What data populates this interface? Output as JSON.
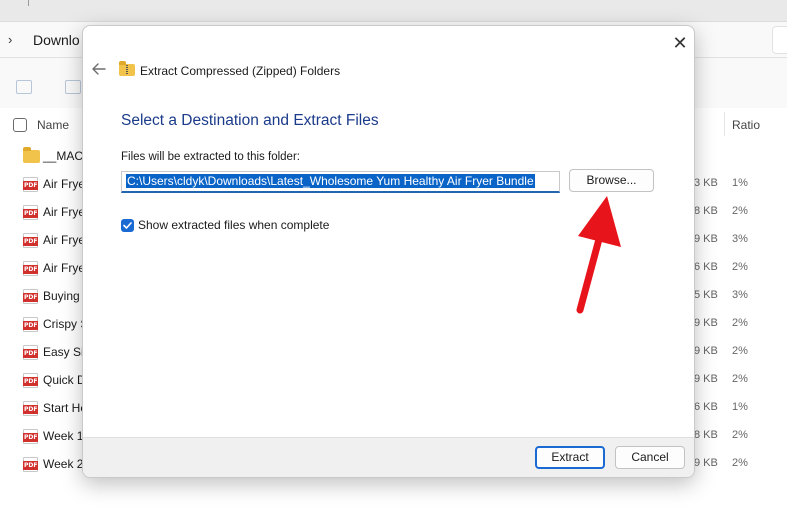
{
  "explorer": {
    "address": "Downlo",
    "columns": {
      "name": "Name",
      "ratio": "Ratio"
    },
    "files": [
      {
        "name": "__MACO",
        "size": "",
        "ratio": "",
        "icon": "folder-icon"
      },
      {
        "name": "Air Frye",
        "size": "3 KB",
        "ratio": "1%",
        "icon": "pdf-icon"
      },
      {
        "name": "Air Frye",
        "size": "8 KB",
        "ratio": "2%",
        "icon": "pdf-icon"
      },
      {
        "name": "Air Frye",
        "size": "9 KB",
        "ratio": "3%",
        "icon": "pdf-icon"
      },
      {
        "name": "Air Frye",
        "size": "6 KB",
        "ratio": "2%",
        "icon": "pdf-icon"
      },
      {
        "name": "Buying",
        "size": "5 KB",
        "ratio": "3%",
        "icon": "pdf-icon"
      },
      {
        "name": "Crispy S",
        "size": "9 KB",
        "ratio": "2%",
        "icon": "pdf-icon"
      },
      {
        "name": "Easy Sic",
        "size": "9 KB",
        "ratio": "2%",
        "icon": "pdf-icon"
      },
      {
        "name": "Quick D",
        "size": "9 KB",
        "ratio": "2%",
        "icon": "pdf-icon"
      },
      {
        "name": "Start He",
        "size": "6 KB",
        "ratio": "1%",
        "icon": "pdf-icon"
      },
      {
        "name": "Week 1",
        "size": "8 KB",
        "ratio": "2%",
        "icon": "pdf-icon"
      },
      {
        "name": "Week 2",
        "size": "9 KB",
        "ratio": "2%",
        "icon": "pdf-icon"
      }
    ],
    "pdf_badge": "PDF"
  },
  "dialog": {
    "title": "Extract Compressed (Zipped) Folders",
    "heading": "Select a Destination and Extract Files",
    "dest_label": "Files will be extracted to this folder:",
    "dest_path": "C:\\Users\\cldyk\\Downloads\\Latest_Wholesome Yum Healthy Air Fryer Bundle",
    "browse_label": "Browse...",
    "show_files_label": "Show extracted files when complete",
    "show_files_checked": true,
    "extract_label": "Extract",
    "cancel_label": "Cancel",
    "close_glyph": "✕"
  },
  "colors": {
    "accent": "#1a6ad4",
    "heading": "#1a3a8a",
    "annotation_arrow": "#e8141b"
  }
}
